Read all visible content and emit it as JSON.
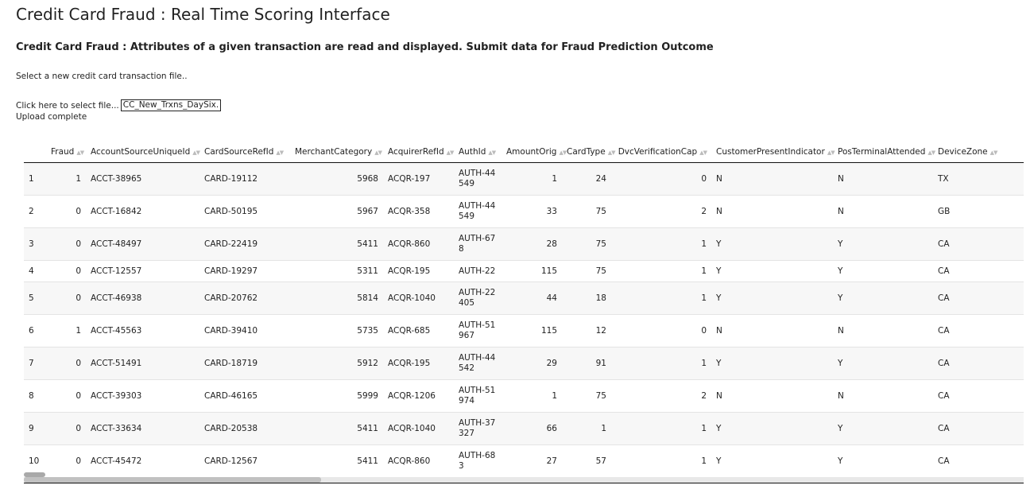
{
  "header": {
    "title": "Credit Card Fraud : Real Time Scoring Interface",
    "subtitle": "Credit Card Fraud : Attributes of a given transaction are read and displayed. Submit data for Fraud Prediction Outcome"
  },
  "upload": {
    "prompt": "Select a new credit card transaction file..",
    "button_label": "Click here to select file...",
    "file_name": "CC_New_Trxns_DaySix.",
    "status": "Upload complete"
  },
  "table": {
    "columns": [
      "",
      "Fraud",
      "AccountSourceUniqueId",
      "CardSourceRefId",
      "MerchantCategory",
      "AcquirerRefId",
      "AuthId",
      "AmountOrig",
      "CardType",
      "DvcVerificationCap",
      "CustomerPresentIndicator",
      "PosTerminalAttended",
      "DeviceZone"
    ],
    "rows": [
      [
        "1",
        "1",
        "ACCT-38965",
        "CARD-19112",
        "5968",
        "ACQR-197",
        "AUTH-44549",
        "1",
        "24",
        "0",
        "N",
        "N",
        "TX"
      ],
      [
        "2",
        "0",
        "ACCT-16842",
        "CARD-50195",
        "5967",
        "ACQR-358",
        "AUTH-44549",
        "33",
        "75",
        "2",
        "N",
        "N",
        "GB"
      ],
      [
        "3",
        "0",
        "ACCT-48497",
        "CARD-22419",
        "5411",
        "ACQR-860",
        "AUTH-678",
        "28",
        "75",
        "1",
        "Y",
        "Y",
        "CA"
      ],
      [
        "4",
        "0",
        "ACCT-12557",
        "CARD-19297",
        "5311",
        "ACQR-195",
        "AUTH-22",
        "115",
        "75",
        "1",
        "Y",
        "Y",
        "CA"
      ],
      [
        "5",
        "0",
        "ACCT-46938",
        "CARD-20762",
        "5814",
        "ACQR-1040",
        "AUTH-22405",
        "44",
        "18",
        "1",
        "Y",
        "Y",
        "CA"
      ],
      [
        "6",
        "1",
        "ACCT-45563",
        "CARD-39410",
        "5735",
        "ACQR-685",
        "AUTH-51967",
        "115",
        "12",
        "0",
        "N",
        "N",
        "CA"
      ],
      [
        "7",
        "0",
        "ACCT-51491",
        "CARD-18719",
        "5912",
        "ACQR-195",
        "AUTH-44542",
        "29",
        "91",
        "1",
        "Y",
        "Y",
        "CA"
      ],
      [
        "8",
        "0",
        "ACCT-39303",
        "CARD-46165",
        "5999",
        "ACQR-1206",
        "AUTH-51974",
        "1",
        "75",
        "2",
        "N",
        "N",
        "CA"
      ],
      [
        "9",
        "0",
        "ACCT-33634",
        "CARD-20538",
        "5411",
        "ACQR-1040",
        "AUTH-37327",
        "66",
        "1",
        "1",
        "Y",
        "Y",
        "CA"
      ],
      [
        "10",
        "0",
        "ACCT-45472",
        "CARD-12567",
        "5411",
        "ACQR-860",
        "AUTH-683",
        "27",
        "57",
        "1",
        "Y",
        "Y",
        "CA"
      ]
    ]
  }
}
